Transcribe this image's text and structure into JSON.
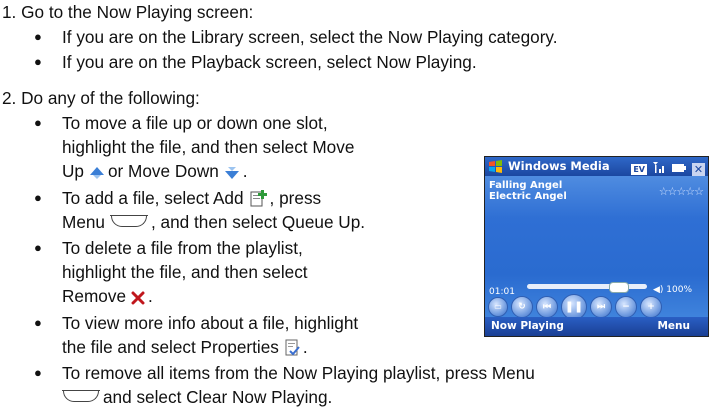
{
  "steps": [
    {
      "num": "1.",
      "text": "Go to the Now Playing screen:"
    },
    {
      "num": "2.",
      "text": "Do any of the following:"
    }
  ],
  "step1_bullets": [
    "If you are on the Library screen, select the Now Playing category.",
    "If you are on the Playback screen, select Now Playing."
  ],
  "step2_bullets": {
    "b1_l1": "To move a file up or down one slot,",
    "b1_l2": "highlight the file, and then select Move",
    "b1_l3a": "Up",
    "b1_l3b": "or Move Down",
    "b1_l3c": ".",
    "b2_l1a": "To add a file, select Add",
    "b2_l1b": ", press",
    "b2_l2a": "Menu",
    "b2_l2b": ", and then select Queue Up.",
    "b3_l1": "To delete a file from the playlist,",
    "b3_l2": "highlight the file, and then select",
    "b3_l3a": "Remove",
    "b3_l3b": ".",
    "b4_l1": "To view more info about a file, highlight",
    "b4_l2a": "the file and select Properties",
    "b4_l2b": ".",
    "b5_l1": "To remove all items from the Now Playing playlist, press Menu",
    "b5_l2": "and select Clear Now Playing."
  },
  "device": {
    "title": "Windows Media",
    "tray_ev": "EV",
    "track_title": "Falling Angel",
    "track_artist": "Electric Angel",
    "stars": "☆☆☆☆☆",
    "time": "01:01",
    "volume": "◀) 100%",
    "menubar_left": "Now Playing",
    "menubar_right": "Menu",
    "seek_position": 0.8
  },
  "colors": {
    "up_arrow": "#3b7fd6",
    "add_icon": "#2e9a3a",
    "remove_x": "#c0161c",
    "properties_icon": "#3b6fd0"
  },
  "icons": [
    "up-arrow-icon",
    "down-arrow-icon",
    "add-file-icon",
    "menu-key-icon",
    "remove-x-icon",
    "properties-icon"
  ]
}
